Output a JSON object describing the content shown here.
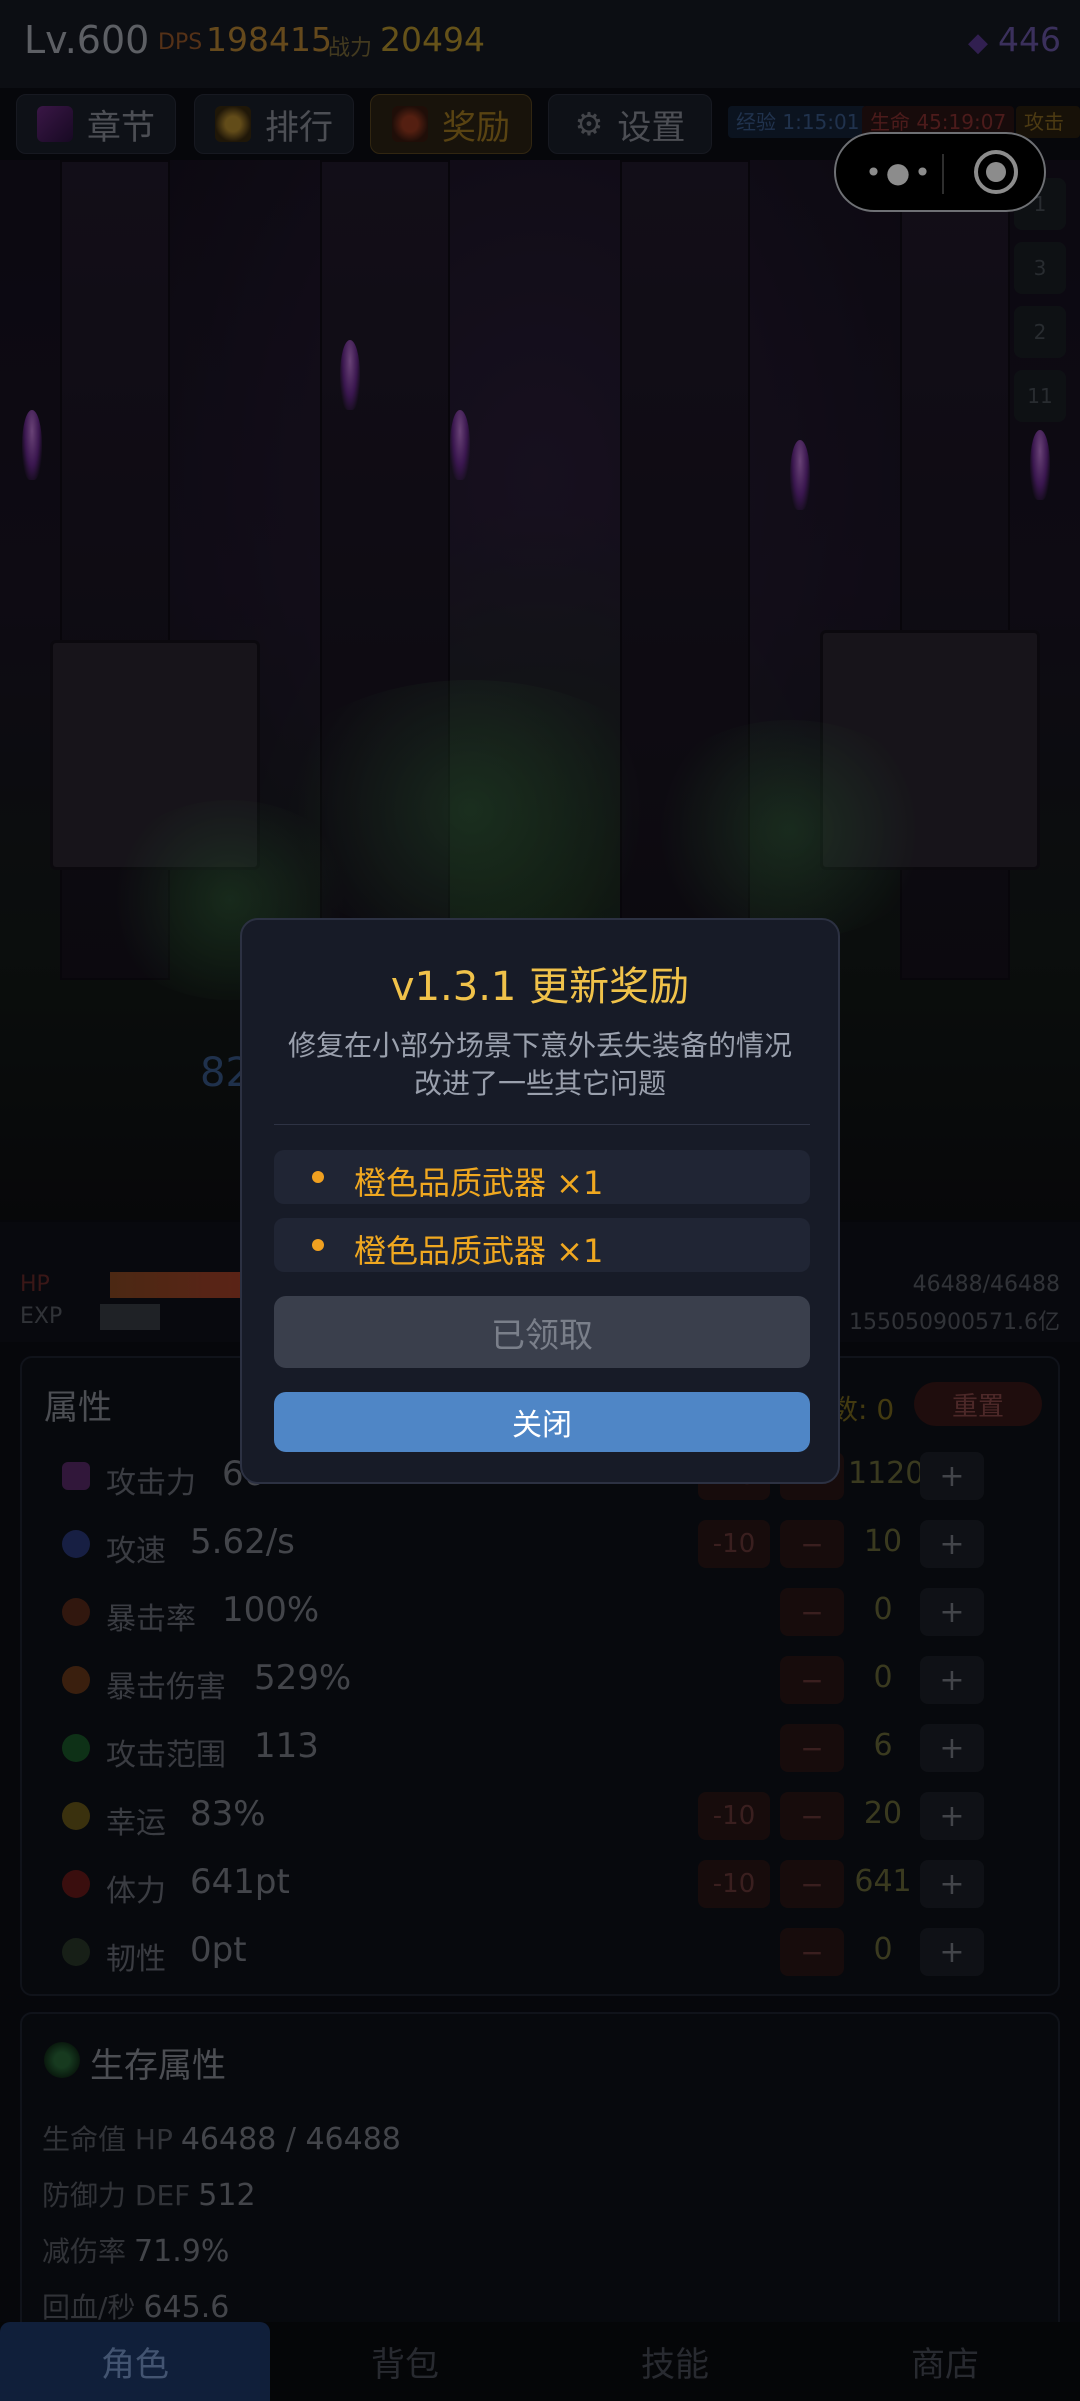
{
  "header": {
    "level": "Lv.600",
    "dps_label": "DPS",
    "dps_value": "198415",
    "power_label": "战力",
    "power_value": "20494",
    "gem_value": "446"
  },
  "menu": {
    "chapter": "章节",
    "rank": "排行",
    "reward": "奖励",
    "settings": "设置"
  },
  "status_tags": {
    "exp": "经验 1:15:01",
    "life": "生命 45:19:07",
    "attack": "攻击"
  },
  "waves": [
    "1",
    "3",
    "2",
    "11"
  ],
  "scene": {
    "floating_number": "82"
  },
  "bars": {
    "hp_label": "HP",
    "exp_label": "EXP",
    "hp_value": "46488/46488",
    "exp_value": "155050900571.6亿"
  },
  "attributes": {
    "title": "属性",
    "points_label": "数: 0",
    "reset": "重置",
    "minus10": "-10",
    "minus": "−",
    "plus": "+",
    "rows": [
      {
        "name": "攻击力",
        "value": "66",
        "alloc": "1120",
        "has_minus10": true
      },
      {
        "name": "攻速",
        "value": "5.62/s",
        "alloc": "10",
        "has_minus10": true
      },
      {
        "name": "暴击率",
        "value": "100%",
        "alloc": "0",
        "has_minus10": false
      },
      {
        "name": "暴击伤害",
        "value": "529%",
        "alloc": "0",
        "has_minus10": false
      },
      {
        "name": "攻击范围",
        "value": "113",
        "alloc": "6",
        "has_minus10": false
      },
      {
        "name": "幸运",
        "value": "83%",
        "alloc": "20",
        "has_minus10": true
      },
      {
        "name": "体力",
        "value": "641pt",
        "alloc": "641",
        "has_minus10": true
      },
      {
        "name": "韧性",
        "value": "0pt",
        "alloc": "0",
        "has_minus10": false
      }
    ]
  },
  "survival": {
    "title": "生存属性",
    "rows": [
      {
        "label": "生命值 HP",
        "value": "46488 / 46488"
      },
      {
        "label": "防御力 DEF",
        "value": "512"
      },
      {
        "label": "减伤率",
        "value": "71.9%"
      },
      {
        "label": "回血/秒",
        "value": "645.6"
      }
    ]
  },
  "tabs": [
    "角色",
    "背包",
    "技能",
    "商店"
  ],
  "dialog": {
    "title": "v1.3.1 更新奖励",
    "desc_line1": "修复在小部分场景下意外丢失装备的情况",
    "desc_line2": "改进了一些其它问题",
    "rewards": [
      "橙色品质武器 ×1",
      "橙色品质武器 ×1"
    ],
    "claimed_button": "已领取",
    "close_button": "关闭"
  },
  "colors": {
    "dialog_title": "#f0c24a",
    "reward_text": "#f0a820",
    "close_button": "#4f86c6",
    "active_tab": "#1e3a6a"
  }
}
